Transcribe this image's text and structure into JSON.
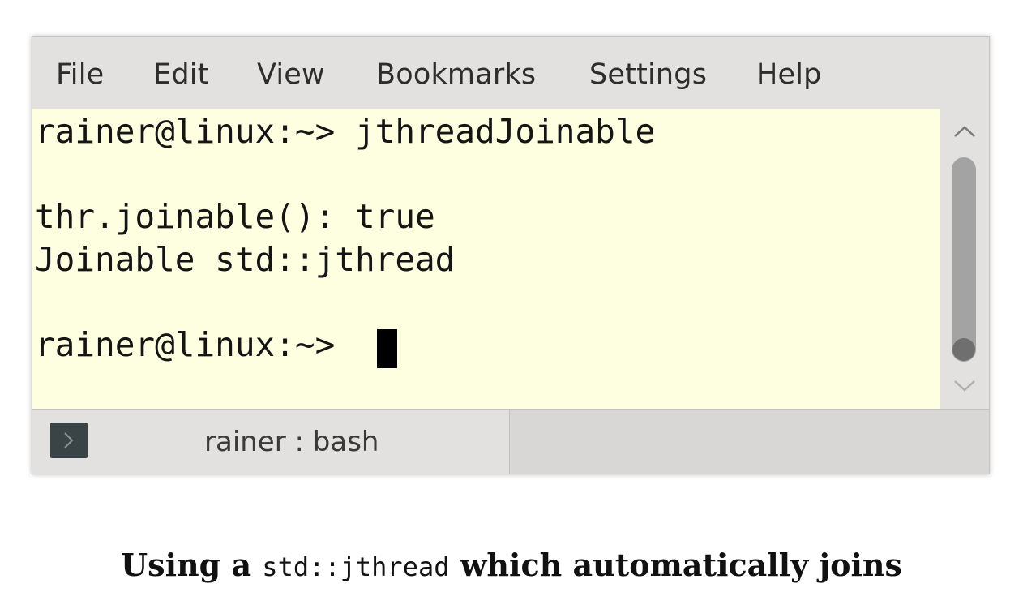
{
  "menubar": {
    "items": [
      "File",
      "Edit",
      "View",
      "Bookmarks",
      "Settings",
      "Help"
    ]
  },
  "terminal": {
    "lines": [
      "rainer@linux:~> jthreadJoinable",
      "",
      "thr.joinable(): true",
      "Joinable std::jthread",
      "",
      "rainer@linux:~> "
    ]
  },
  "tab": {
    "label": "rainer : bash",
    "icon": "terminal-prompt-icon"
  },
  "caption": {
    "before": "Using a ",
    "code": "std::jthread",
    "after": " which automatically joins"
  },
  "colors": {
    "terminal_background": "#fefee0",
    "window_chrome": "#e3e1e0",
    "text": "#151515"
  }
}
